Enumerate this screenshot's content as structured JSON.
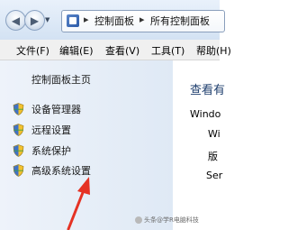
{
  "address_bar": {
    "crumb_1": "控制面板",
    "separator": "▸",
    "crumb_2": "所有控制面板"
  },
  "menu": {
    "file": "文件(F)",
    "edit": "编辑(E)",
    "view": "查看(V)",
    "tools": "工具(T)",
    "help": "帮助(H)"
  },
  "sidebar": {
    "home": "控制面板主页",
    "items": [
      {
        "label": "设备管理器"
      },
      {
        "label": "远程设置"
      },
      {
        "label": "系统保护"
      },
      {
        "label": "高级系统设置"
      }
    ]
  },
  "main": {
    "title": "查看有",
    "windows_label": "Windo",
    "row1": "Wi",
    "row2": "版",
    "row3": "Ser"
  },
  "watermark": {
    "text": "头条@学R电脑科技"
  },
  "colors": {
    "annotation_arrow": "#e53224",
    "link_text": "#1f3f6e"
  }
}
